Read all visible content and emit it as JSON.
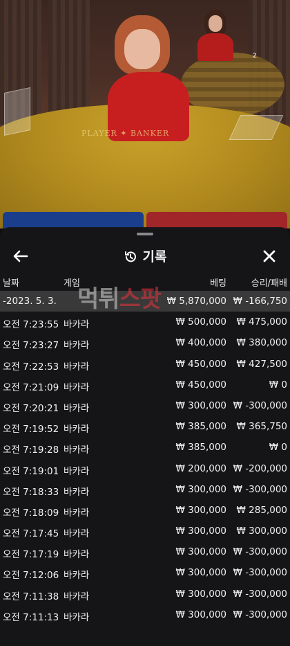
{
  "sheet": {
    "title": "기록",
    "icons": {
      "back": "arrow-left-icon",
      "history": "history-icon",
      "close": "close-icon"
    }
  },
  "columns": {
    "date": "날짜",
    "game": "게임",
    "bet": "베팅",
    "result": "승리/패배"
  },
  "summary": {
    "date": "-2023. 5. 3.",
    "bet": "₩ 5,870,000",
    "result": "₩ -166,750"
  },
  "rows": [
    {
      "time": "오전 7:23:55",
      "game": "바카라",
      "bet": "₩ 500,000",
      "result": "₩ 475,000"
    },
    {
      "time": "오전 7:23:27",
      "game": "바카라",
      "bet": "₩ 400,000",
      "result": "₩ 380,000"
    },
    {
      "time": "오전 7:22:53",
      "game": "바카라",
      "bet": "₩ 450,000",
      "result": "₩ 427,500"
    },
    {
      "time": "오전 7:21:09",
      "game": "바카라",
      "bet": "₩ 450,000",
      "result": "₩ 0"
    },
    {
      "time": "오전 7:20:21",
      "game": "바카라",
      "bet": "₩ 300,000",
      "result": "₩ -300,000"
    },
    {
      "time": "오전 7:19:52",
      "game": "바카라",
      "bet": "₩ 385,000",
      "result": "₩ 365,750"
    },
    {
      "time": "오전 7:19:28",
      "game": "바카라",
      "bet": "₩ 385,000",
      "result": "₩ 0"
    },
    {
      "time": "오전 7:19:01",
      "game": "바카라",
      "bet": "₩ 200,000",
      "result": "₩ -200,000"
    },
    {
      "time": "오전 7:18:33",
      "game": "바카라",
      "bet": "₩ 300,000",
      "result": "₩ -300,000"
    },
    {
      "time": "오전 7:18:09",
      "game": "바카라",
      "bet": "₩ 300,000",
      "result": "₩ 285,000"
    },
    {
      "time": "오전 7:17:45",
      "game": "바카라",
      "bet": "₩ 300,000",
      "result": "₩ 300,000"
    },
    {
      "time": "오전 7:17:19",
      "game": "바카라",
      "bet": "₩ 300,000",
      "result": "₩ -300,000"
    },
    {
      "time": "오전 7:12:06",
      "game": "바카라",
      "bet": "₩ 300,000",
      "result": "₩ -300,000"
    },
    {
      "time": "오전 7:11:38",
      "game": "바카라",
      "bet": "₩ 300,000",
      "result": "₩ -300,000"
    },
    {
      "time": "오전 7:11:13",
      "game": "바카라",
      "bet": "₩ 300,000",
      "result": "₩ -300,000"
    }
  ],
  "video": {
    "table_text": "PLAYER ✦ BANKER",
    "mini_number": "2"
  },
  "watermark": {
    "part1": "먹튀",
    "part2": "스팟"
  },
  "colors": {
    "banker": "#a0262a",
    "player": "#1b3e8c",
    "felt": "#b18a1e",
    "watermark_red": "#e8323a"
  }
}
